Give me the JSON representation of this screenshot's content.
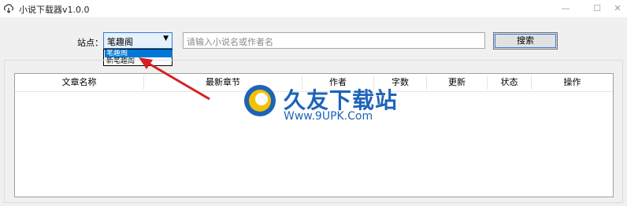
{
  "window": {
    "title": "小说下载器v1.0.0",
    "minimize": "—",
    "maximize": "☐",
    "close": "✕"
  },
  "toolbar": {
    "site_label": "站点：",
    "site_selected": "笔趣阁",
    "site_options": [
      "笔趣阁",
      "新笔趣阁"
    ],
    "search_placeholder": "请输入小说名或作者名",
    "search_button": "搜索"
  },
  "table": {
    "columns": [
      "文章名称",
      "最新章节",
      "作者",
      "字数",
      "更新",
      "状态",
      "操作"
    ]
  },
  "watermark": {
    "brand": "久友下载站",
    "url": "Www.9UPK.Com"
  },
  "colors": {
    "accent": "#0078d7",
    "arrow": "#d42020",
    "watermark": "#1e63b8"
  }
}
